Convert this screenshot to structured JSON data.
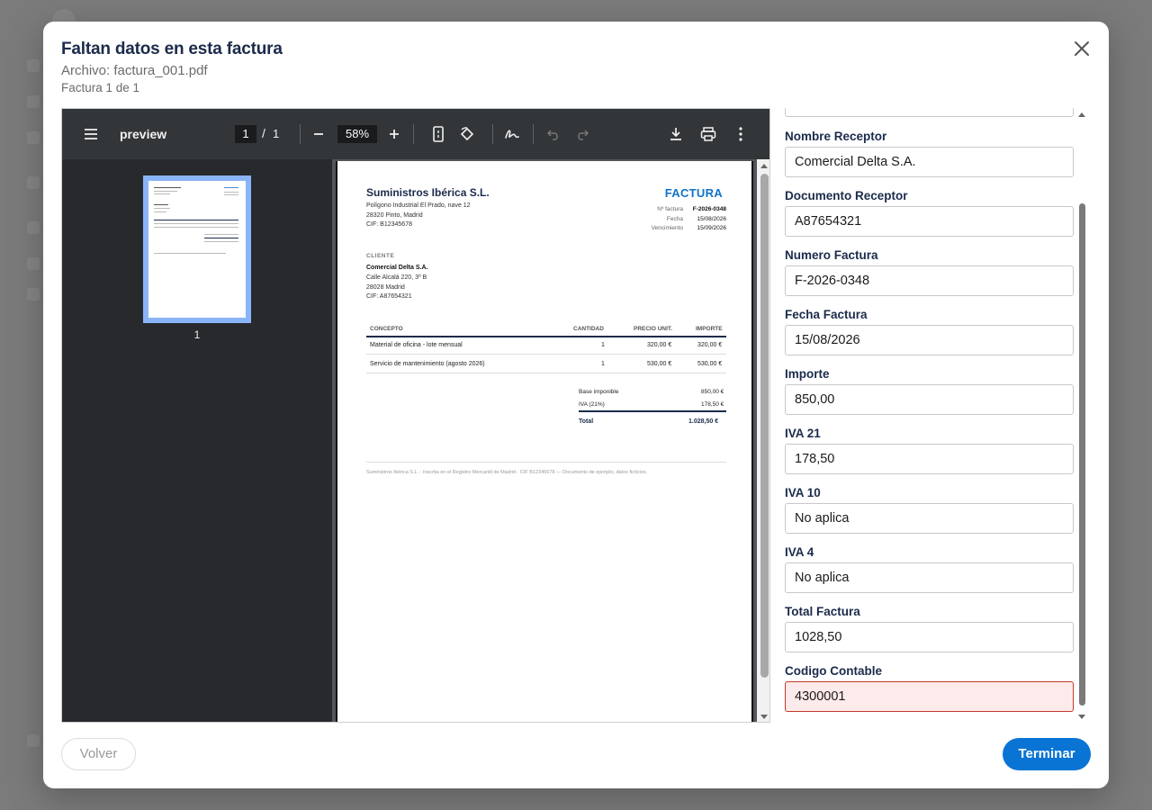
{
  "modal": {
    "title": "Faltan datos en esta factura",
    "file": "Archivo: factura_001.pdf",
    "count": "Factura 1 de 1"
  },
  "viewer": {
    "title": "preview",
    "page_current": "1",
    "page_separator": "/",
    "page_total": "1",
    "zoom": "58%",
    "thumbnail_label": "1"
  },
  "invoice": {
    "company": "Suministros Ibérica S.L.",
    "address1": "Polígono Industrial El Prado, nave 12",
    "address2": "28320 Pinto, Madrid",
    "cif": "CIF: B12345678",
    "heading": "FACTURA",
    "meta": [
      {
        "label": "Nº factura",
        "value": "F-2026-0348"
      },
      {
        "label": "Fecha",
        "value": "15/08/2026"
      },
      {
        "label": "Vencimiento",
        "value": "15/09/2026"
      }
    ],
    "client_heading": "CLIENTE",
    "client_name": "Comercial Delta S.A.",
    "client_address1": "Calle Alcalá 220, 3º B",
    "client_address2": "28028 Madrid",
    "client_cif": "CIF: A87654321",
    "columns": [
      "CONCEPTO",
      "CANTIDAD",
      "PRECIO UNIT.",
      "IMPORTE"
    ],
    "rows": [
      {
        "concepto": "Material de oficina - lote mensual",
        "cantidad": "1",
        "precio": "320,00 €",
        "importe": "320,00 €"
      },
      {
        "concepto": "Servicio de mantenimiento (agosto 2026)",
        "cantidad": "1",
        "precio": "530,00 €",
        "importe": "530,00 €"
      }
    ],
    "totals": [
      {
        "label": "Base imponible",
        "value": "850,00 €"
      },
      {
        "label": "IVA (21%)",
        "value": "178,50 €"
      },
      {
        "label": "Total",
        "value": "1.028,50 €"
      }
    ],
    "footer": "Suministros Ibérica S.L. · Inscrita en el Registro Mercantil de Madrid · CIF B12345678 — Documento de ejemplo, datos ficticios."
  },
  "form": {
    "fields": [
      {
        "label": "Nombre Receptor",
        "value": "Comercial Delta S.A."
      },
      {
        "label": "Documento Receptor",
        "value": "A87654321"
      },
      {
        "label": "Numero Factura",
        "value": "F-2026-0348"
      },
      {
        "label": "Fecha Factura",
        "value": "15/08/2026"
      },
      {
        "label": "Importe",
        "value": "850,00"
      },
      {
        "label": "IVA 21",
        "value": "178,50"
      },
      {
        "label": "IVA 10",
        "value": "No aplica"
      },
      {
        "label": "IVA 4",
        "value": "No aplica"
      },
      {
        "label": "Total Factura",
        "value": "1028,50"
      },
      {
        "label": "Codigo Contable",
        "value": "4300001",
        "error": true
      }
    ]
  },
  "buttons": {
    "back": "Volver",
    "finish": "Terminar"
  },
  "colors": {
    "accent": "#0a74d4",
    "title": "#1b2b4b",
    "error_bg": "#fdeaea",
    "error_border": "#c0392b",
    "invoice_heading": "#1273c8"
  }
}
